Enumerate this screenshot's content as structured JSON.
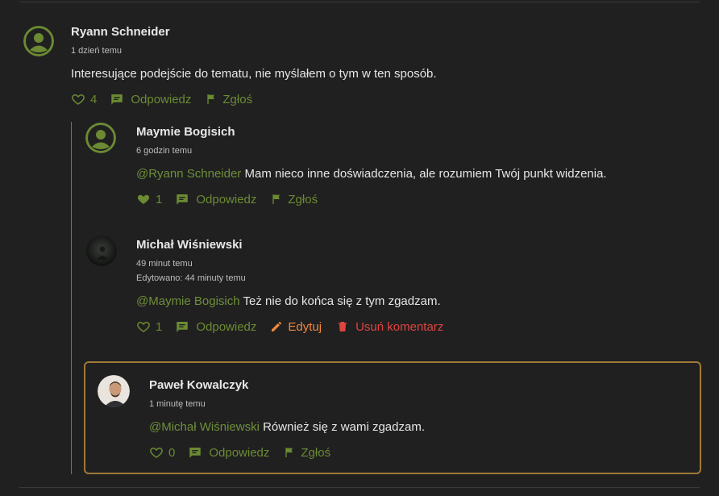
{
  "colors": {
    "accent": "#6b8a33",
    "edit": "#f0883e",
    "delete": "#e0443f",
    "highlight_border": "#a07a37"
  },
  "comments": [
    {
      "author": "Ryann Schneider",
      "time": "1 dzień temu",
      "text": "Interesujące podejście do tematu, nie myślałem o tym w ten sposób.",
      "likes": "4",
      "reply_label": "Odpowiedz",
      "report_label": "Zgłoś",
      "avatar": "default-avatar-icon"
    },
    {
      "author": "Maymie Bogisich",
      "time": "6 godzin temu",
      "mention": "@Ryann Schneider",
      "text": " Mam nieco inne doświadczenia, ale rozumiem Twój punkt widzenia.",
      "likes": "1",
      "reply_label": "Odpowiedz",
      "report_label": "Zgłoś",
      "avatar": "default-avatar-icon"
    },
    {
      "author": "Michał Wiśniewski",
      "time": "49 minut temu",
      "edited": "Edytowano: 44 minuty temu",
      "mention": "@Maymie Bogisich",
      "text": " Też nie do końca się z tym zgadzam.",
      "likes": "1",
      "reply_label": "Odpowiedz",
      "edit_label": "Edytuj",
      "delete_label": "Usuń komentarz",
      "avatar": "user-photo"
    },
    {
      "author": "Paweł Kowalczyk",
      "time": "1 minutę temu",
      "mention": "@Michał Wiśniewski",
      "text": " Również się z wami zgadzam.",
      "likes": "0",
      "reply_label": "Odpowiedz",
      "report_label": "Zgłoś",
      "avatar": "user-photo"
    }
  ]
}
